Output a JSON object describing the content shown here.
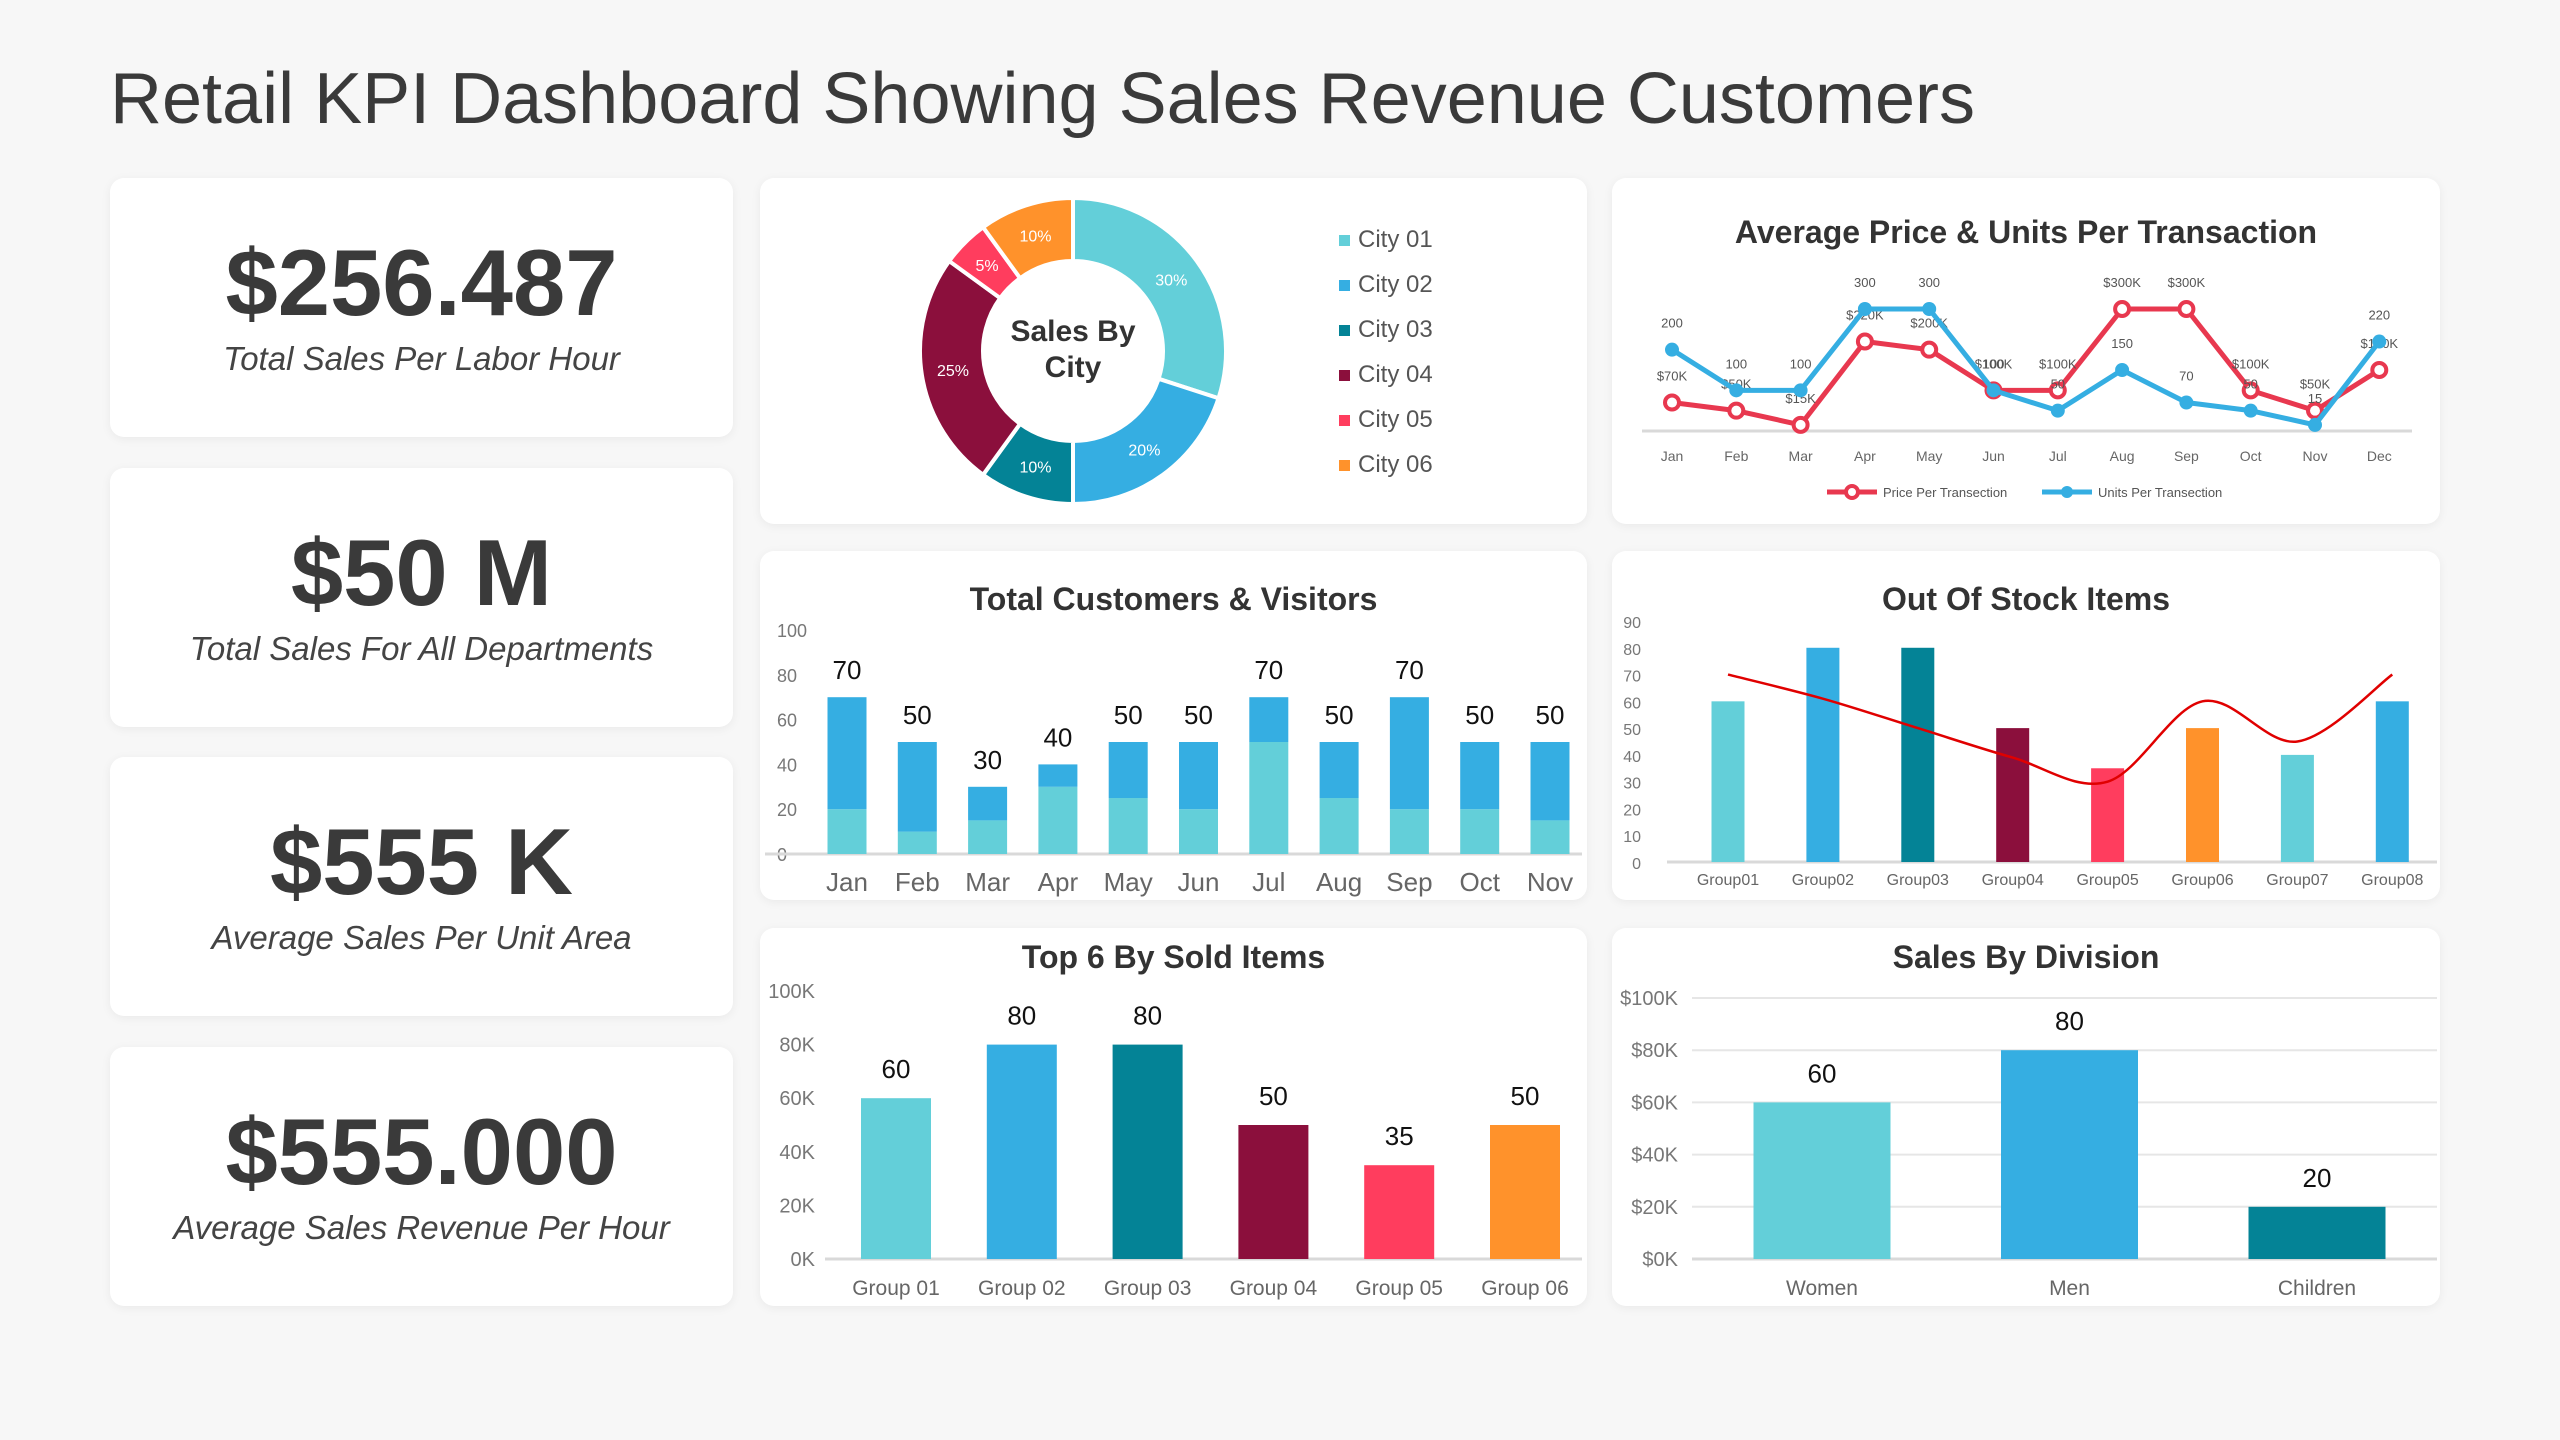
{
  "page_title": "Retail KPI Dashboard Showing Sales Revenue Customers",
  "kpis": [
    {
      "value": "$256.487",
      "label": "Total Sales Per Labor Hour"
    },
    {
      "value": "$50 M",
      "label": "Total Sales For All Departments"
    },
    {
      "value": "$555 K",
      "label": "Average Sales Per Unit Area"
    },
    {
      "value": "$555.000",
      "label": "Average Sales Revenue Per Hour"
    }
  ],
  "colors": {
    "light_teal": "#63CFD9",
    "blue": "#35AEE2",
    "dark_teal": "#048396",
    "maroon": "#8B0F3C",
    "pink": "#FF3D5E",
    "orange": "#FF922B",
    "red_line": "#E8384F",
    "trend_line": "#E00000"
  },
  "chart_data": [
    {
      "type": "pie",
      "donut": true,
      "title": "Sales By City",
      "categories": [
        "City 01",
        "City 02",
        "City 03",
        "City 04",
        "City 05",
        "City 06"
      ],
      "values": [
        30,
        20,
        10,
        25,
        5,
        10
      ],
      "labels": [
        "30%",
        "20%",
        "10%",
        "25%",
        "5%",
        "10%"
      ],
      "colors": [
        "#63CFD9",
        "#35AEE2",
        "#048396",
        "#8B0F3C",
        "#FF3D5E",
        "#FF922B"
      ],
      "legend": "right"
    },
    {
      "type": "line",
      "title": "Average Price & Units Per Transaction",
      "categories": [
        "Jan",
        "Feb",
        "Mar",
        "Apr",
        "May",
        "Jun",
        "Jul",
        "Aug",
        "Sep",
        "Oct",
        "Nov",
        "Dec"
      ],
      "series": [
        {
          "name": "Price Per Transection",
          "color": "#E8384F",
          "marker": "hollow-circle",
          "values": [
            70,
            50,
            15,
            220,
            200,
            100,
            100,
            300,
            300,
            100,
            50,
            150
          ],
          "labels": [
            "$70K",
            "$50K",
            "$15K",
            "$220K",
            "$200K",
            "$100K",
            "$100K",
            "$300K",
            "$300K",
            "$100K",
            "$50K",
            "$150K"
          ]
        },
        {
          "name": "Units Per Transection",
          "color": "#35AEE2",
          "marker": "filled-circle",
          "values": [
            200,
            100,
            100,
            300,
            300,
            100,
            50,
            150,
            70,
            50,
            15,
            220
          ],
          "labels": [
            "200",
            "100",
            "100",
            "300",
            "300",
            "100",
            "50",
            "150",
            "70",
            "50",
            "15",
            "220"
          ]
        }
      ],
      "ylim": [
        0,
        300
      ],
      "legend": "bottom"
    },
    {
      "type": "bar",
      "stacked": true,
      "title": "Total Customers & Visitors",
      "categories": [
        "Jan",
        "Feb",
        "Mar",
        "Apr",
        "May",
        "Jun",
        "Jul",
        "Aug",
        "Sep",
        "Oct",
        "Nov"
      ],
      "series": [
        {
          "color": "#63CFD9",
          "values": [
            20,
            10,
            15,
            30,
            25,
            20,
            50,
            25,
            20,
            20,
            15
          ]
        },
        {
          "color": "#35AEE2",
          "values": [
            50,
            40,
            15,
            10,
            25,
            30,
            20,
            25,
            50,
            30,
            35
          ]
        }
      ],
      "totals": [
        "70",
        "50",
        "30",
        "40",
        "50",
        "50",
        "70",
        "50",
        "70",
        "50",
        "50"
      ],
      "ylim": [
        0,
        100
      ],
      "yticks": [
        "0",
        "20",
        "40",
        "60",
        "80",
        "100"
      ]
    },
    {
      "type": "bar",
      "title": "Out Of Stock Items",
      "categories": [
        "Group01",
        "Group02",
        "Group03",
        "Group04",
        "Group05",
        "Group06",
        "Group07",
        "Group08"
      ],
      "values": [
        60,
        80,
        80,
        50,
        35,
        50,
        40,
        60
      ],
      "colors": [
        "#63CFD9",
        "#35AEE2",
        "#048396",
        "#8B0F3C",
        "#FF3D5E",
        "#FF922B",
        "#63CFD9",
        "#35AEE2"
      ],
      "line": {
        "values": [
          70,
          61,
          50,
          39,
          30,
          60,
          45,
          70
        ],
        "smooth": true,
        "color": "#E00000"
      },
      "ylim": [
        0,
        90
      ],
      "yticks": [
        "0",
        "10",
        "20",
        "30",
        "40",
        "50",
        "60",
        "70",
        "80",
        "90"
      ]
    },
    {
      "type": "bar",
      "title": "Top 6 By Sold Items",
      "categories": [
        "Group 01",
        "Group 02",
        "Group 03",
        "Group 04",
        "Group 05",
        "Group 06"
      ],
      "values": [
        60,
        80,
        80,
        50,
        35,
        50
      ],
      "value_labels": [
        "60",
        "80",
        "80",
        "50",
        "35",
        "50"
      ],
      "colors": [
        "#63CFD9",
        "#35AEE2",
        "#048396",
        "#8B0F3C",
        "#FF3D5E",
        "#FF922B"
      ],
      "ylim": [
        0,
        100
      ],
      "yticks": [
        "0K",
        "20K",
        "40K",
        "60K",
        "80K",
        "100K"
      ]
    },
    {
      "type": "bar",
      "title": "Sales By Division",
      "categories": [
        "Women",
        "Men",
        "Children"
      ],
      "values": [
        60,
        80,
        20
      ],
      "value_labels": [
        "60",
        "80",
        "20"
      ],
      "colors": [
        "#63CFD9",
        "#35AEE2",
        "#048396"
      ],
      "ylim": [
        0,
        100
      ],
      "yticks": [
        "$0K",
        "$20K",
        "$40K",
        "$60K",
        "$80K",
        "$100K"
      ],
      "grid": true
    }
  ]
}
